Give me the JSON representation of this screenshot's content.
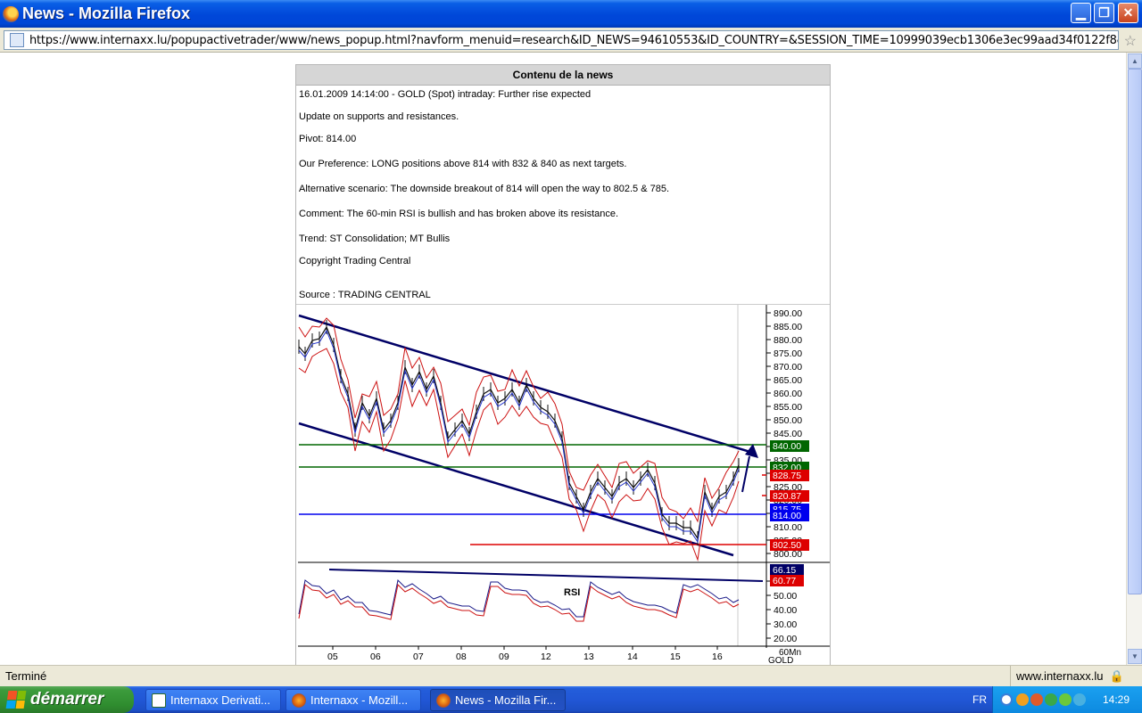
{
  "window": {
    "title": "News - Mozilla Firefox"
  },
  "address": {
    "url": "https://www.internaxx.lu/popupactivetrader/www/news_popup.html?navform_menuid=research&ID_NEWS=94610553&ID_COUNTRY=&SESSION_TIME=10999039ecb1306e3ec99aad34f0122f8&ID_CUST_USER=ec"
  },
  "news": {
    "header": "Contenu de la news",
    "headline": "16.01.2009 14:14:00 - GOLD (Spot) intraday: Further rise expected",
    "update": "Update on supports and resistances.",
    "pivot": "Pivot: 814.00",
    "preference": "Our Preference: LONG positions above 814 with 832 & 840 as next targets.",
    "alternative": "Alternative scenario: The downside breakout of 814 will open the way to 802.5 & 785.",
    "comment": "Comment: The 60-min RSI is bullish and has broken above its resistance.",
    "trend": "Trend: ST Consolidation; MT Bullis",
    "copyright": "Copyright Trading Central",
    "source": "Source : TRADING CENTRAL"
  },
  "chart": {
    "price_ticks": [
      "890.00",
      "885.00",
      "880.00",
      "875.00",
      "870.00",
      "865.00",
      "860.00",
      "855.00",
      "850.00",
      "845.00",
      "840.00",
      "835.00",
      "830.00",
      "825.00",
      "820.00",
      "815.00",
      "810.00",
      "805.00",
      "800.00"
    ],
    "rsi_ticks": [
      "60.00",
      "50.00",
      "40.00",
      "30.00",
      "20.00"
    ],
    "x_labels": [
      "05",
      "06",
      "07",
      "08",
      "09",
      "12",
      "13",
      "14",
      "15",
      "16"
    ],
    "rsi_label": "RSI",
    "timeframe": "60Mn",
    "instrument": "GOLD",
    "levels": [
      {
        "label": "840.00",
        "color": "#006600"
      },
      {
        "label": "832.00",
        "color": "#006600"
      },
      {
        "label": "828.75",
        "color": "#dd0000"
      },
      {
        "label": "820.87",
        "color": "#dd0000"
      },
      {
        "label": "815.75",
        "color": "#0000ee"
      },
      {
        "label": "814.00",
        "color": "#0000ee"
      },
      {
        "label": "802.50",
        "color": "#dd0000"
      }
    ],
    "rsi_levels": [
      {
        "label": "66.15",
        "color": "#000066"
      },
      {
        "label": "60.77",
        "color": "#dd0000"
      }
    ]
  },
  "status": {
    "text": "Terminé",
    "host": "www.internaxx.lu"
  },
  "taskbar": {
    "start": "démarrer",
    "tasks": [
      "Internaxx Derivati...",
      "Internaxx - Mozill...",
      "News - Mozilla Fir..."
    ],
    "lang": "FR",
    "clock": "14:29"
  }
}
